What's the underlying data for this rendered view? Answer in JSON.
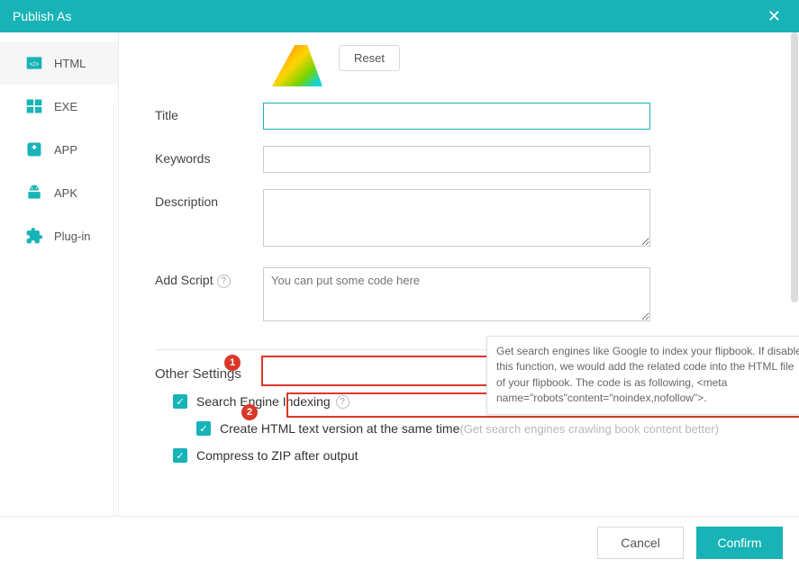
{
  "window": {
    "title": "Publish As"
  },
  "sidebar": {
    "items": [
      {
        "label": "HTML"
      },
      {
        "label": "EXE"
      },
      {
        "label": "APP"
      },
      {
        "label": "APK"
      },
      {
        "label": "Plug-in"
      }
    ]
  },
  "form": {
    "reset_label": "Reset",
    "title_label": "Title",
    "keywords_label": "Keywords",
    "description_label": "Description",
    "addscript_label": "Add Script",
    "addscript_placeholder": "You can put some code here"
  },
  "other": {
    "section_title": "Other Settings",
    "search_indexing_label": "Search Engine Indexing",
    "create_html_label": "Create HTML text version at the same time",
    "create_html_hint": "(Get search engines crawling book content better)",
    "compress_label": "Compress to ZIP after output"
  },
  "tooltip": {
    "text": "Get search engines like Google to index your flipbook. If disable this function, we would add the related code into the HTML file of your flipbook. The code is as following, <meta name=\"robots\"content=\"noindex,nofollow\">."
  },
  "annotations": {
    "badge1": "1",
    "badge2": "2"
  },
  "footer": {
    "cancel": "Cancel",
    "confirm": "Confirm"
  }
}
